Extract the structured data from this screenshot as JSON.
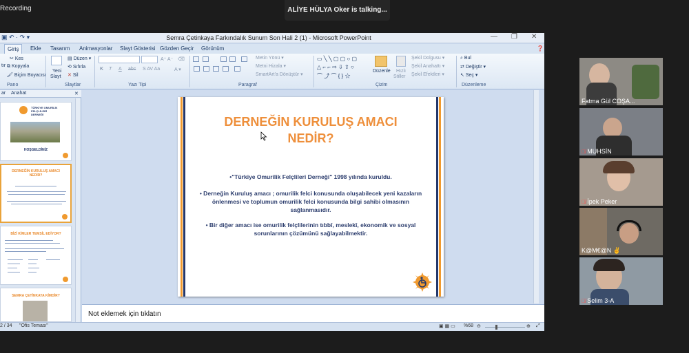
{
  "meeting": {
    "recording_label": "Recording",
    "talking_label": "ALİYE HÜLYA Oker is talking..."
  },
  "ppt": {
    "window_title": "Semra Çetinkaya Farkındalık Sunum Son Hali 2 (1) - Microsoft PowerPoint",
    "tabs": [
      "Giriş",
      "Ekle",
      "Tasarım",
      "Animasyonlar",
      "Slayt Gösterisi",
      "Gözden Geçir",
      "Görünüm"
    ],
    "ribbon": {
      "pano": {
        "label": "Pano",
        "kes": "Kes",
        "kopyala": "Kopyala",
        "bicim": "Biçim Boyacısı",
        "yapistir": "tır"
      },
      "slaytlar": {
        "label": "Slaytlar",
        "yeni": "Yeni",
        "yeni2": "Slayt",
        "duzen": "Düzen",
        "sifirla": "Sıfırla",
        "sil": "Sil"
      },
      "yazi": {
        "label": "Yazı Tipi",
        "bold": "K",
        "italic": "T",
        "underline": "A",
        "strike": "abc"
      },
      "paragraf": {
        "label": "Paragraf",
        "metin_yonu": "Metin Yönü",
        "metni_hizala": "Metni Hizala",
        "smartart": "SmartArt'a Dönüştür"
      },
      "cizim": {
        "label": "Çizim",
        "duzenle": "Düzenle",
        "hizli": "Hızlı",
        "stiller": "Stiller",
        "sekil_dolgusu": "Şekil Dolgusu",
        "sekil_anahatti": "Şekil Anahattı",
        "sekil_efektleri": "Şekil Efektleri"
      },
      "duzenleme": {
        "label": "Düzenleme",
        "bul": "Bul",
        "degistir": "Değiştir",
        "sec": "Seç"
      }
    },
    "panel": {
      "tab1": "ar",
      "tab2": "Anahat",
      "slides": [
        {
          "num": "",
          "title": "HOŞGELDİNİZ"
        },
        {
          "num": "",
          "title": "DERNEĞİN KURULUŞ AMACI NEDİR?"
        },
        {
          "num": "",
          "title": "BİZİ KİMLER TEMSİL EDİYOR?"
        },
        {
          "num": "",
          "title": "SEMRA ÇETİNKAYA KİMDİR?"
        }
      ],
      "logo_text": "TÜRKİYE OMURİLİK FELÇLİLERİ DERNEĞİ"
    },
    "slide": {
      "title_line1": "DERNEĞİN KURULUŞ AMACI",
      "title_line2": "NEDİR?",
      "bullet1": "•\"Türkiye Omurilik Felçlileri Derneği\" 1998 yılında kuruldu.",
      "bullet2_l1": "• Derneğin Kuruluş amacı ; omurilik felci konusunda  oluşabilecek yeni kazaların",
      "bullet2_l2": "önlenmesi ve toplumun omurilik felci konusunda bilgi sahibi olmasının",
      "bullet2_l3": "sağlanmasıdır.",
      "bullet3_l1": "• Bir diğer amacı ise omurilik felçlilerinin tıbbî, meslekî, ekonomik ve sosyal",
      "bullet3_l2": "sorunlarının çözümünü sağlayabilmektir."
    },
    "notes_placeholder": "Not eklemek için tıklatın",
    "status": {
      "slide_of": "2 / 34",
      "theme": "\"Ofis Teması\"",
      "zoom": "%68"
    }
  },
  "participants": [
    {
      "name": "Fatma Gül COŞA...",
      "muted": false,
      "bg": "#8d8a84"
    },
    {
      "name": "MUHSİN",
      "muted": true,
      "bg": "#7b7f86"
    },
    {
      "name": "İpek Peker",
      "muted": true,
      "bg": "#a59a8f"
    },
    {
      "name": "K@M€@N ✌️",
      "muted": false,
      "bg": "#6e6a63"
    },
    {
      "name": "Selim 3-A",
      "muted": true,
      "bg": "#8f9aa3"
    }
  ]
}
